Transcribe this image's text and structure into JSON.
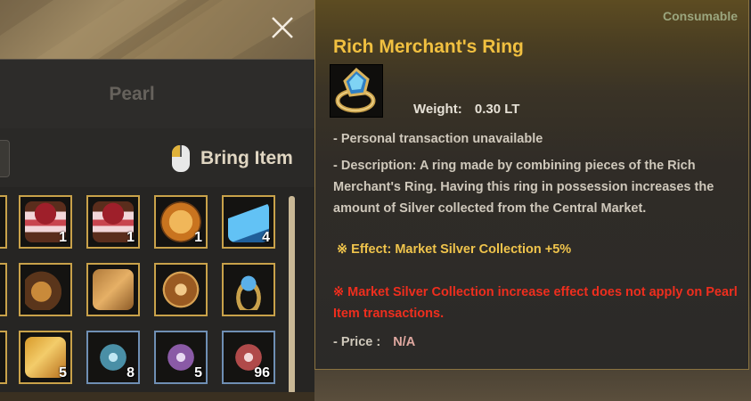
{
  "inventory": {
    "tab_label": "Pearl",
    "bring_item_label": "Bring Item",
    "slots": [
      {
        "name": "cake-slot",
        "count": "1",
        "art": "cake"
      },
      {
        "name": "cake-slot",
        "count": "1",
        "art": "cake"
      },
      {
        "name": "pie-slot",
        "count": "1",
        "art": "pie"
      },
      {
        "name": "potion-slot",
        "count": "4",
        "art": "potion"
      },
      {
        "name": "treasure-slot",
        "count": "",
        "art": "chest"
      },
      {
        "name": "map-slot",
        "count": "",
        "art": "map"
      },
      {
        "name": "compass-slot",
        "count": "",
        "art": "compass"
      },
      {
        "name": "ring-slot",
        "count": "",
        "art": "ring"
      },
      {
        "name": "scroll-slot",
        "count": "5",
        "art": "scroll"
      },
      {
        "name": "crystal-slot",
        "count": "8",
        "art": "crystal-blue"
      },
      {
        "name": "crystal-slot",
        "count": "5",
        "art": "crystal-purple"
      },
      {
        "name": "crystal-slot",
        "count": "96",
        "art": "crystal-red"
      }
    ]
  },
  "tooltip": {
    "type_label": "Consumable",
    "title": "Rich Merchant's Ring",
    "weight_label": "Weight:",
    "weight_value": "0.30 LT",
    "personal": "- Personal transaction unavailable",
    "description": "- Description: A ring made by combining pieces of the Rich Merchant's Ring. Having this ring in possession increases the amount of Silver collected from the Central Market.",
    "effect": "※ Effect: Market Silver Collection +5%",
    "warning": "※ Market Silver Collection increase effect does not apply on Pearl Item transactions.",
    "price_label": "- Price :",
    "price_value": "N/A"
  },
  "colors": {
    "title": "#f1c040",
    "effect": "#f0c44c",
    "warning": "#ee2e1e",
    "slot_border_gold": "#c9a24a",
    "slot_border_blue": "#6f8fb4"
  }
}
